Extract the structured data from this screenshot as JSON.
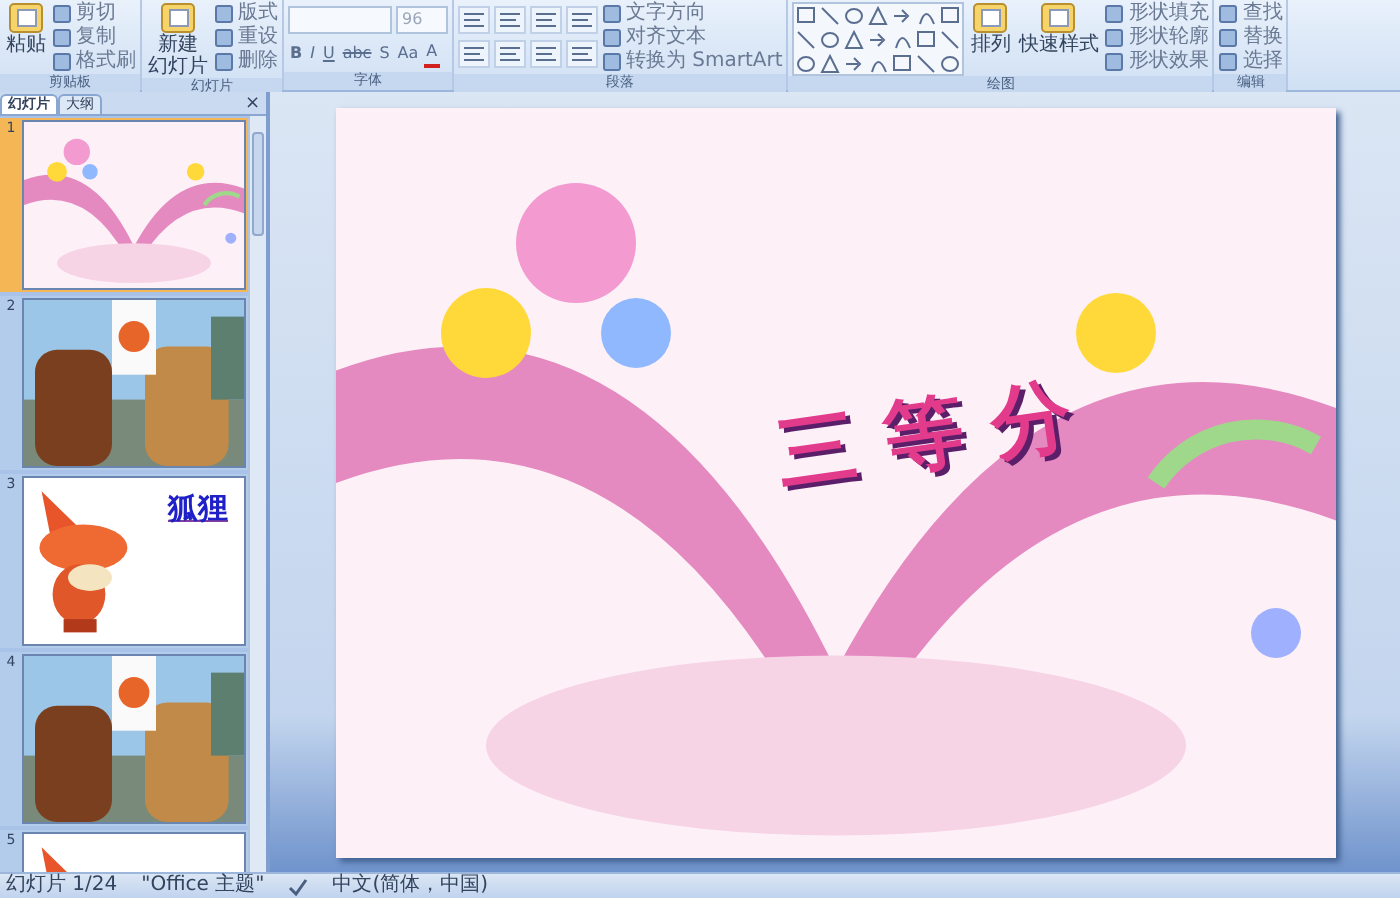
{
  "ribbon": {
    "groups": [
      {
        "kind": "clipboard",
        "label": "剪贴板",
        "large": [
          {
            "label": "粘贴"
          }
        ],
        "small": [
          {
            "label": "剪切"
          },
          {
            "label": "复制"
          },
          {
            "label": "格式刷"
          }
        ]
      },
      {
        "kind": "slides",
        "label": "幻灯片",
        "large": [
          {
            "lines": [
              "新建",
              "幻灯片"
            ]
          }
        ],
        "small": [
          {
            "label": "版式"
          },
          {
            "label": "重设"
          },
          {
            "label": "删除"
          }
        ]
      },
      {
        "kind": "font",
        "label": "字体",
        "font": {
          "size": "96",
          "buttons": [
            "B",
            "I",
            "U",
            "abc",
            "S",
            "Aa",
            "A"
          ]
        }
      },
      {
        "kind": "paragraph",
        "label": "段落",
        "small": [
          {
            "label": "文字方向"
          },
          {
            "label": "对齐文本"
          },
          {
            "label": "转换为 SmartArt"
          }
        ]
      },
      {
        "kind": "drawing",
        "label": "绘图",
        "large": [
          {
            "label": "排列"
          },
          {
            "label": "快速样式"
          }
        ],
        "small": [
          {
            "label": "形状填充"
          },
          {
            "label": "形状轮廓"
          },
          {
            "label": "形状效果"
          }
        ]
      },
      {
        "kind": "editing",
        "label": "编辑",
        "small": [
          {
            "label": "查找"
          },
          {
            "label": "替换"
          },
          {
            "label": "选择"
          }
        ]
      }
    ]
  },
  "panel": {
    "tabs": [
      {
        "label": "幻灯片",
        "selected": true
      },
      {
        "label": "大纲",
        "selected": false
      }
    ],
    "close": "×",
    "slides": [
      {
        "number": "1",
        "selected": true
      },
      {
        "number": "2",
        "selected": false
      },
      {
        "number": "3",
        "selected": false,
        "title": "狐狸"
      },
      {
        "number": "4",
        "selected": false
      },
      {
        "number": "5",
        "selected": false
      }
    ]
  },
  "slide": {
    "title": "三等分"
  },
  "status_bar": [
    "幻灯片 1/24",
    "\"Office 主题\"",
    "中文(简体，中国)"
  ]
}
